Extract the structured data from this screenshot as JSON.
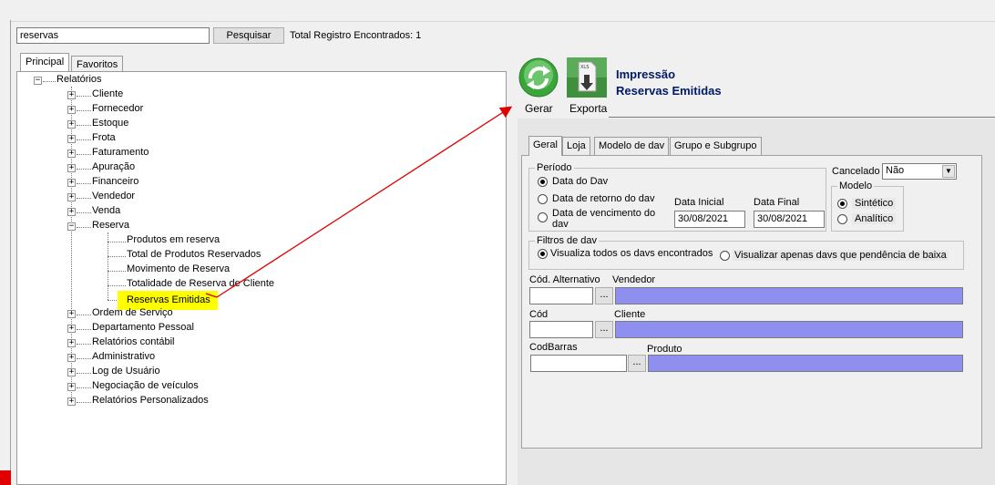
{
  "search": {
    "value": "reservas",
    "button_label": "Pesquisar",
    "total_label": "Total Registro Encontrados: 1"
  },
  "tree_tabs": [
    "Principal",
    "Favoritos"
  ],
  "tree": {
    "root": "Relatórios",
    "items": [
      "Cliente",
      "Fornecedor",
      "Estoque",
      "Frota",
      "Faturamento",
      "Apuração",
      "Financeiro",
      "Vendedor",
      "Venda",
      "Reserva"
    ],
    "reserva_children": [
      "Produtos em reserva",
      "Total de Produtos Reservados",
      "Movimento de Reserva",
      "Totalidade de Reserva de Cliente",
      "Reservas Emitidas"
    ],
    "items_after": [
      "Ordem de Serviço",
      "Departamento Pessoal",
      "Relatórios contábil",
      "Administrativo",
      "Log de Usuário",
      "Negociação de veículos",
      "Relatórios Personalizados"
    ]
  },
  "toolbar": {
    "gerar_label": "Gerar",
    "exporta_label": "Exporta",
    "title_line1": "Impressão",
    "title_line2": "Reservas Emitidas"
  },
  "form_tabs": [
    "Geral",
    "Loja",
    "Modelo de dav",
    "Grupo e Subgrupo"
  ],
  "periodo": {
    "legend": "Período",
    "options": [
      "Data do Dav",
      "Data de retorno do dav",
      "Data de vencimento do",
      "dav"
    ],
    "data_inicial_label": "Data Inicial",
    "data_inicial_value": "30/08/2021",
    "data_final_label": "Data Final",
    "data_final_value": "30/08/2021"
  },
  "cancelado": {
    "label": "Cancelado",
    "value": "Não"
  },
  "modelo": {
    "legend": "Modelo",
    "options": [
      "Sintético",
      "Analítico"
    ]
  },
  "filtros": {
    "legend": "Filtros de dav",
    "option1": "Visualiza todos os davs encontrados",
    "option2": "Visualizar apenas davs que pendência de baixa"
  },
  "fields": {
    "cod_alternativo": "Cód. Alternativo",
    "vendedor": "Vendedor",
    "cod": "Cód",
    "cliente": "Cliente",
    "codbarras": "CodBarras",
    "produto": "Produto",
    "dots": "..."
  },
  "colors": {
    "highlight": "#ffff00",
    "lookup_blue": "#8f8ff0",
    "title_blue": "#001a66",
    "arrow_red": "#e00000"
  }
}
